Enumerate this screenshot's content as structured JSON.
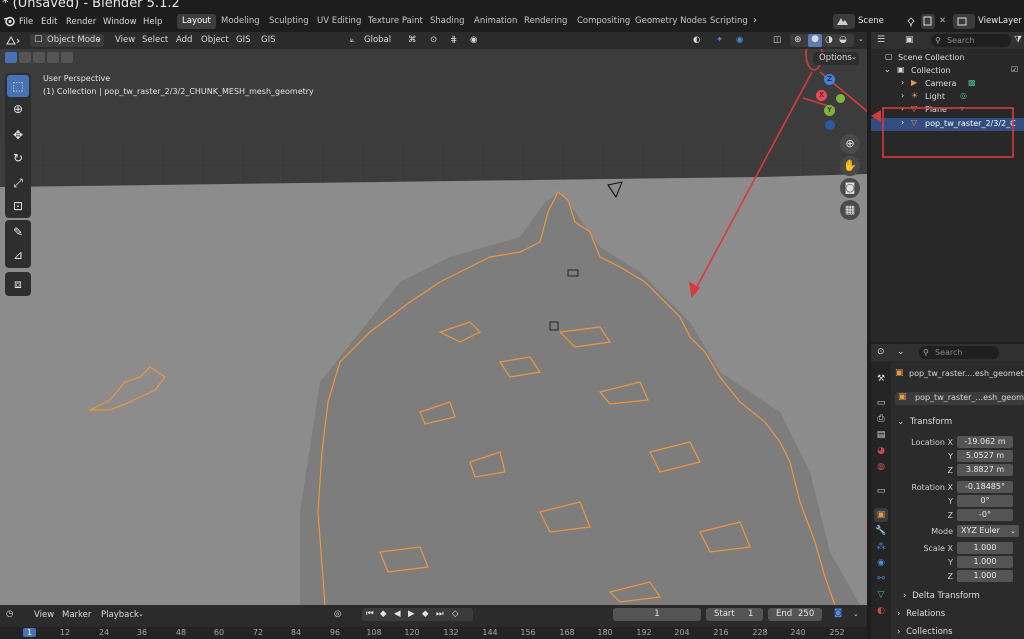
{
  "window": {
    "title": "* (Unsaved) - Blender 5.1.2"
  },
  "menu": [
    "File",
    "Edit",
    "Render",
    "Window",
    "Help"
  ],
  "workspaces": [
    "Layout",
    "Modeling",
    "Sculpting",
    "UV Editing",
    "Texture Paint",
    "Shading",
    "Animation",
    "Rendering",
    "Compositing",
    "Geometry Nodes",
    "Scripting"
  ],
  "active_workspace": "Layout",
  "scene": {
    "name": "Scene",
    "view_layer": "ViewLayer"
  },
  "viewport": {
    "mode": "Object Mode",
    "menus": [
      "View",
      "Select",
      "Add",
      "Object",
      "GIS",
      "GIS"
    ],
    "orientation": "Global",
    "options_label": "Options",
    "perspective_label": "User Perspective",
    "object_info": "(1) Collection | pop_tw_raster_2/3/2_CHUNK_MESH_mesh_geometry",
    "gizmo_axes": [
      "X",
      "Y",
      "Z"
    ]
  },
  "outliner": {
    "search_placeholder": "Search",
    "root": "Scene Collection",
    "items": [
      {
        "label": "Collection",
        "type": "collection"
      },
      {
        "label": "Camera",
        "type": "camera"
      },
      {
        "label": "Light",
        "type": "light"
      },
      {
        "label": "Plane",
        "type": "mesh"
      },
      {
        "label": "pop_tw_raster_2/3/2_C",
        "type": "mesh",
        "selected": true
      }
    ]
  },
  "properties": {
    "search_placeholder": "Search",
    "object_name": "pop_tw_raster....esh_geometry",
    "data_name": "pop_tw_raster_...esh_geome",
    "transform_label": "Transform",
    "location": {
      "label": "Location X",
      "x": "-19.062 m",
      "y": "5.0527 m",
      "z": "3.8827 m"
    },
    "rotation": {
      "label": "Rotation X",
      "x": "-0.18485°",
      "y": "0°",
      "z": "-0°"
    },
    "mode_label": "Mode",
    "mode_value": "XYZ Euler",
    "scale": {
      "label": "Scale X",
      "x": "1.000",
      "y": "1.000",
      "z": "1.000"
    },
    "axis_y": "Y",
    "axis_z": "Z",
    "delta_transform": "Delta Transform",
    "relations": "Relations",
    "collections": "Collections"
  },
  "timeline": {
    "menus": [
      "View",
      "Marker",
      "Playback"
    ],
    "current_frame": "1",
    "start_label": "Start",
    "start_value": "1",
    "end_label": "End",
    "end_value": "250",
    "ruler_ticks": [
      "1",
      "12",
      "24",
      "36",
      "48",
      "60",
      "72",
      "84",
      "96",
      "108",
      "120",
      "132",
      "144",
      "156",
      "168",
      "180",
      "192",
      "204",
      "216",
      "228",
      "240",
      "252"
    ]
  },
  "colors": {
    "selection_orange": "#f0963a",
    "annotation_red": "#d63b3b",
    "active_blue": "#4772b3",
    "axis_x": "#e44c5b",
    "axis_y": "#7fb43a",
    "axis_z": "#3f82dc"
  }
}
